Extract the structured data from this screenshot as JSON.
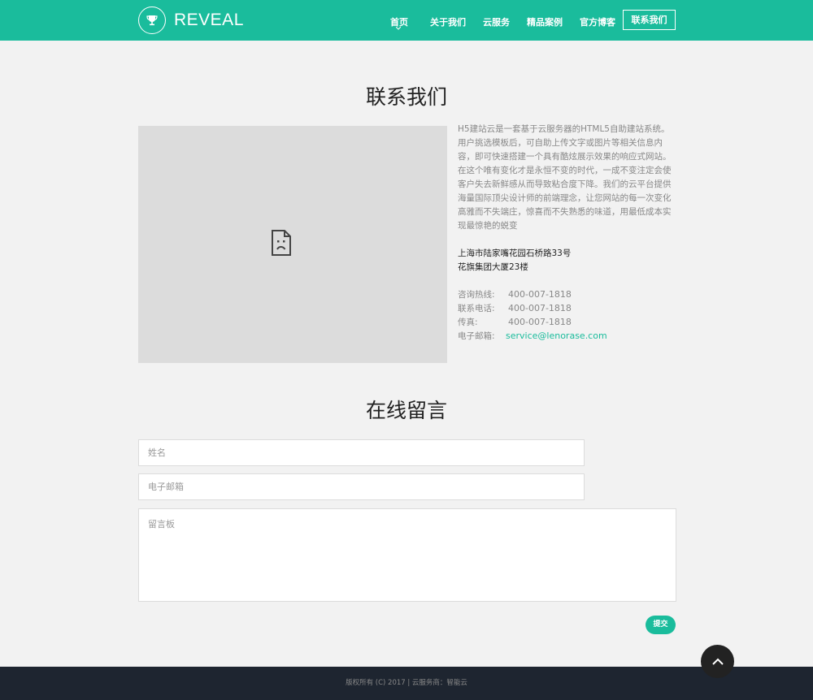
{
  "brand": {
    "name": "REVEAL",
    "logo_icon": "trophy-icon"
  },
  "nav": {
    "items": [
      "首页",
      "关于我们",
      "云服务",
      "精品案例",
      "官方博客"
    ],
    "active_index": 0,
    "button_label": "联系我们"
  },
  "contact": {
    "title": "联系我们",
    "description": "H5建站云是一套基于云服务器的HTML5自助建站系统。用户挑选模板后，可自助上传文字或图片等相关信息内容，即可快速搭建一个具有酷炫展示效果的响应式网站。在这个唯有变化才是永恒不变的时代，一成不变注定会使客户失去新鲜感从而导致粘合度下降。我们的云平台提供海量国际顶尖设计师的前端理念，让您网站的每一次变化高雅而不失端庄，惊喜而不失熟悉的味道，用最低成本实现最惊艳的蜕变",
    "address_line1": "上海市陆家嘴花园石桥路33号",
    "address_line2": "花旗集团大厦23楼",
    "rows": [
      {
        "label": "咨询热线:",
        "value": "400-007-1818"
      },
      {
        "label": "联系电话:",
        "value": "400-007-1818"
      },
      {
        "label": "传真:",
        "value": "400-007-1818"
      },
      {
        "label": "电子邮箱:",
        "value": "service@lenorase.com"
      }
    ]
  },
  "form": {
    "title": "在线留言",
    "name_placeholder": "姓名",
    "email_placeholder": "电子邮箱",
    "message_placeholder": "留言板",
    "submit_label": "提交"
  },
  "footer": {
    "text": "版权所有 (C) 2017 | 云服务商：智能云"
  },
  "colors": {
    "accent": "#1abc9c",
    "footer_bg": "#1e2530",
    "page_bg": "#f2f2f2"
  }
}
